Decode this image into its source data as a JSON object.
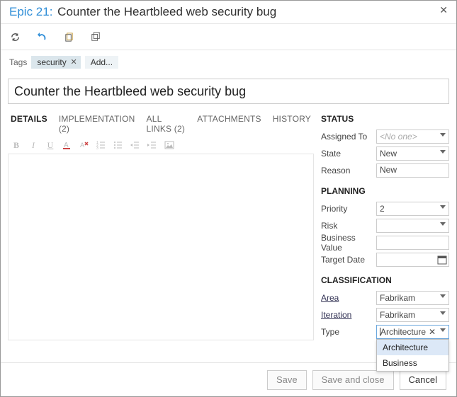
{
  "header": {
    "epic_prefix": "Epic 21:",
    "epic_title": "Counter the Heartbleed web security bug"
  },
  "tags": {
    "label": "Tags",
    "items": [
      "security"
    ],
    "add_label": "Add..."
  },
  "title_field": {
    "value": "Counter the Heartbleed web security bug"
  },
  "tabs": [
    {
      "label": "DETAILS",
      "active": true
    },
    {
      "label": "IMPLEMENTATION (2)",
      "active": false
    },
    {
      "label": "ALL LINKS (2)",
      "active": false
    },
    {
      "label": "ATTACHMENTS",
      "active": false
    },
    {
      "label": "HISTORY",
      "active": false
    }
  ],
  "rt_icons": [
    "bold",
    "italic",
    "underline",
    "font-color",
    "clear-format",
    "ordered-list",
    "unordered-list",
    "indent",
    "outdent",
    "image"
  ],
  "side": {
    "status": {
      "heading": "STATUS",
      "assigned_to_label": "Assigned To",
      "assigned_to_value": "<No one>",
      "state_label": "State",
      "state_value": "New",
      "reason_label": "Reason",
      "reason_value": "New"
    },
    "planning": {
      "heading": "PLANNING",
      "priority_label": "Priority",
      "priority_value": "2",
      "risk_label": "Risk",
      "risk_value": "",
      "bv_label": "Business Value",
      "bv_value": "",
      "target_label": "Target Date",
      "target_value": ""
    },
    "classification": {
      "heading": "CLASSIFICATION",
      "area_label": "Area",
      "area_value": "Fabrikam",
      "iteration_label": "Iteration",
      "iteration_value": "Fabrikam",
      "type_label": "Type",
      "type_value": "Architecture",
      "type_options": [
        "Architecture",
        "Business"
      ]
    }
  },
  "footer": {
    "save": "Save",
    "save_close": "Save and close",
    "cancel": "Cancel"
  }
}
